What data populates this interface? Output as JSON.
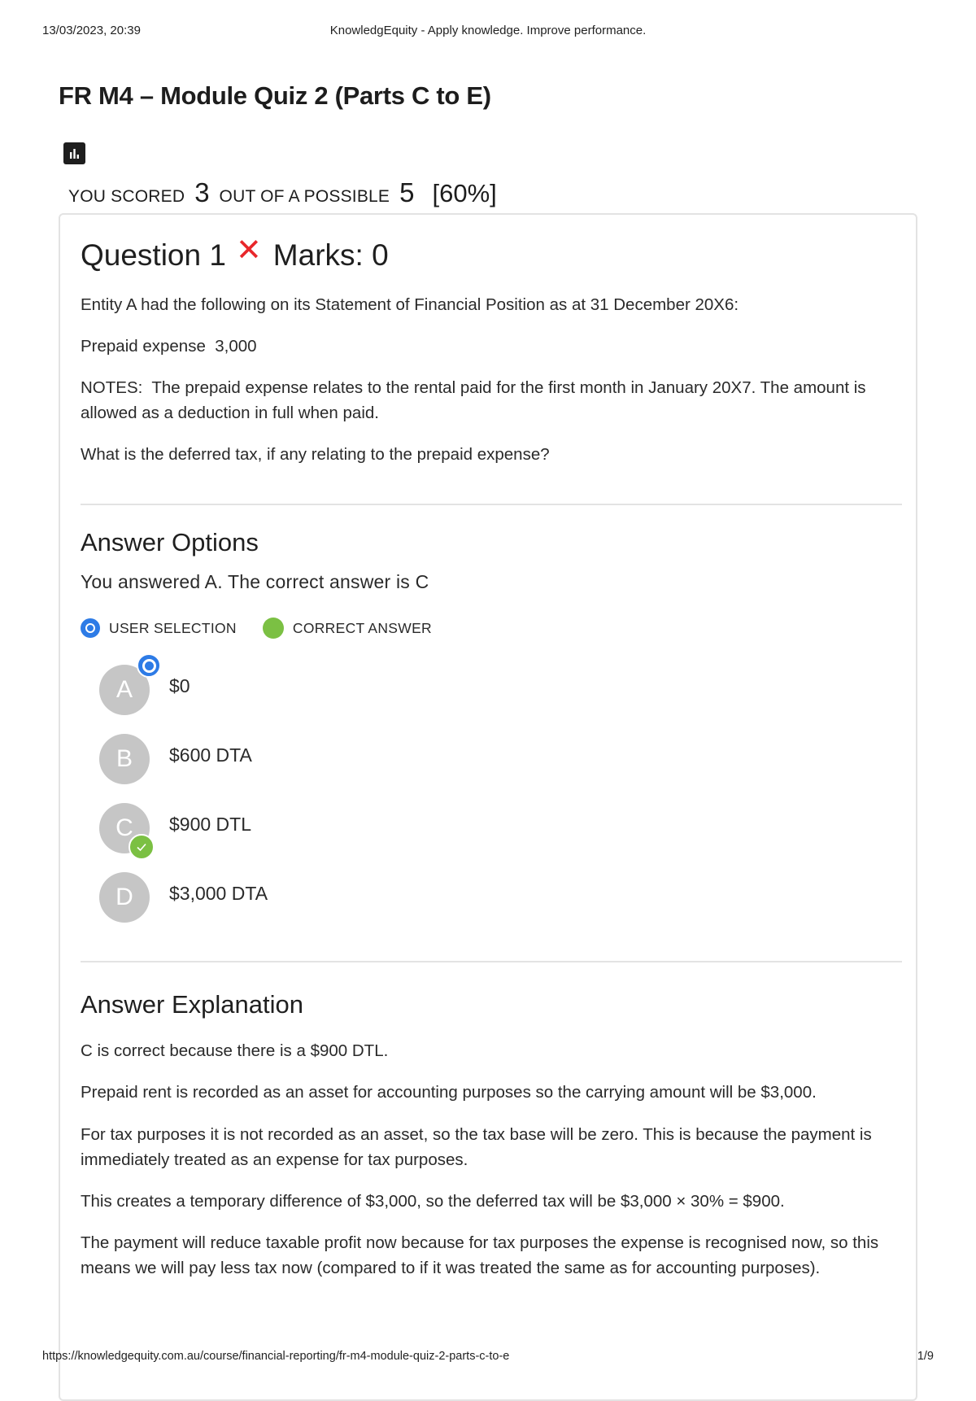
{
  "print_header": {
    "date": "13/03/2023, 20:39",
    "title": "KnowledgEquity - Apply knowledge. Improve performance."
  },
  "print_footer": {
    "url": "https://knowledgequity.com.au/course/financial-reporting/fr-m4-module-quiz-2-parts-c-to-e",
    "page": "1/9"
  },
  "quiz": {
    "title": "FR M4 – Module Quiz 2 (Parts C to E)",
    "stats_icon": "bar-chart-icon",
    "score": {
      "prefix": "YOU SCORED",
      "scored": "3",
      "middle": "OUT OF A POSSIBLE",
      "possible": "5",
      "percent": "[60%]"
    }
  },
  "question": {
    "title": "Question 1",
    "result_icon": "cross-icon",
    "result_color": "#e8272b",
    "marks": "Marks: 0",
    "paragraphs": [
      "Entity A had the following on its Statement of Financial Position as at 31 December 20X6:",
      "Prepaid expense  3,000",
      "NOTES:  The prepaid expense relates to the rental paid for the first month in January 20X7. The amount is allowed as a deduction in full when paid.",
      "What is the deferred tax, if any relating to the prepaid expense?"
    ]
  },
  "answer_options": {
    "heading": "Answer Options",
    "summary": "You answered A. The correct answer is C",
    "legend": {
      "user_label": "USER SELECTION",
      "user_color": "#2d7be6",
      "correct_label": "CORRECT ANSWER",
      "correct_color": "#7bc043"
    },
    "options": [
      {
        "letter": "A",
        "text": "$0",
        "user_selected": true,
        "correct": false
      },
      {
        "letter": "B",
        "text": "$600 DTA",
        "user_selected": false,
        "correct": false
      },
      {
        "letter": "C",
        "text": "$900 DTL",
        "user_selected": false,
        "correct": true
      },
      {
        "letter": "D",
        "text": "$3,000 DTA",
        "user_selected": false,
        "correct": false
      }
    ]
  },
  "explanation": {
    "heading": "Answer Explanation",
    "paragraphs": [
      "C is correct because there is a $900 DTL.",
      "Prepaid rent is recorded as an asset for accounting purposes so the carrying amount will be $3,000.",
      "For tax purposes it is not recorded as an asset, so the tax base will be zero. This is because the payment is immediately treated as an expense for tax purposes.",
      "This creates a temporary difference of $3,000, so the deferred tax will be $3,000 × 30% = $900.",
      "The payment will reduce taxable profit now because for tax purposes the expense is recognised now, so this means we will pay less tax now (compared to if it was treated the same as for accounting purposes)."
    ]
  }
}
